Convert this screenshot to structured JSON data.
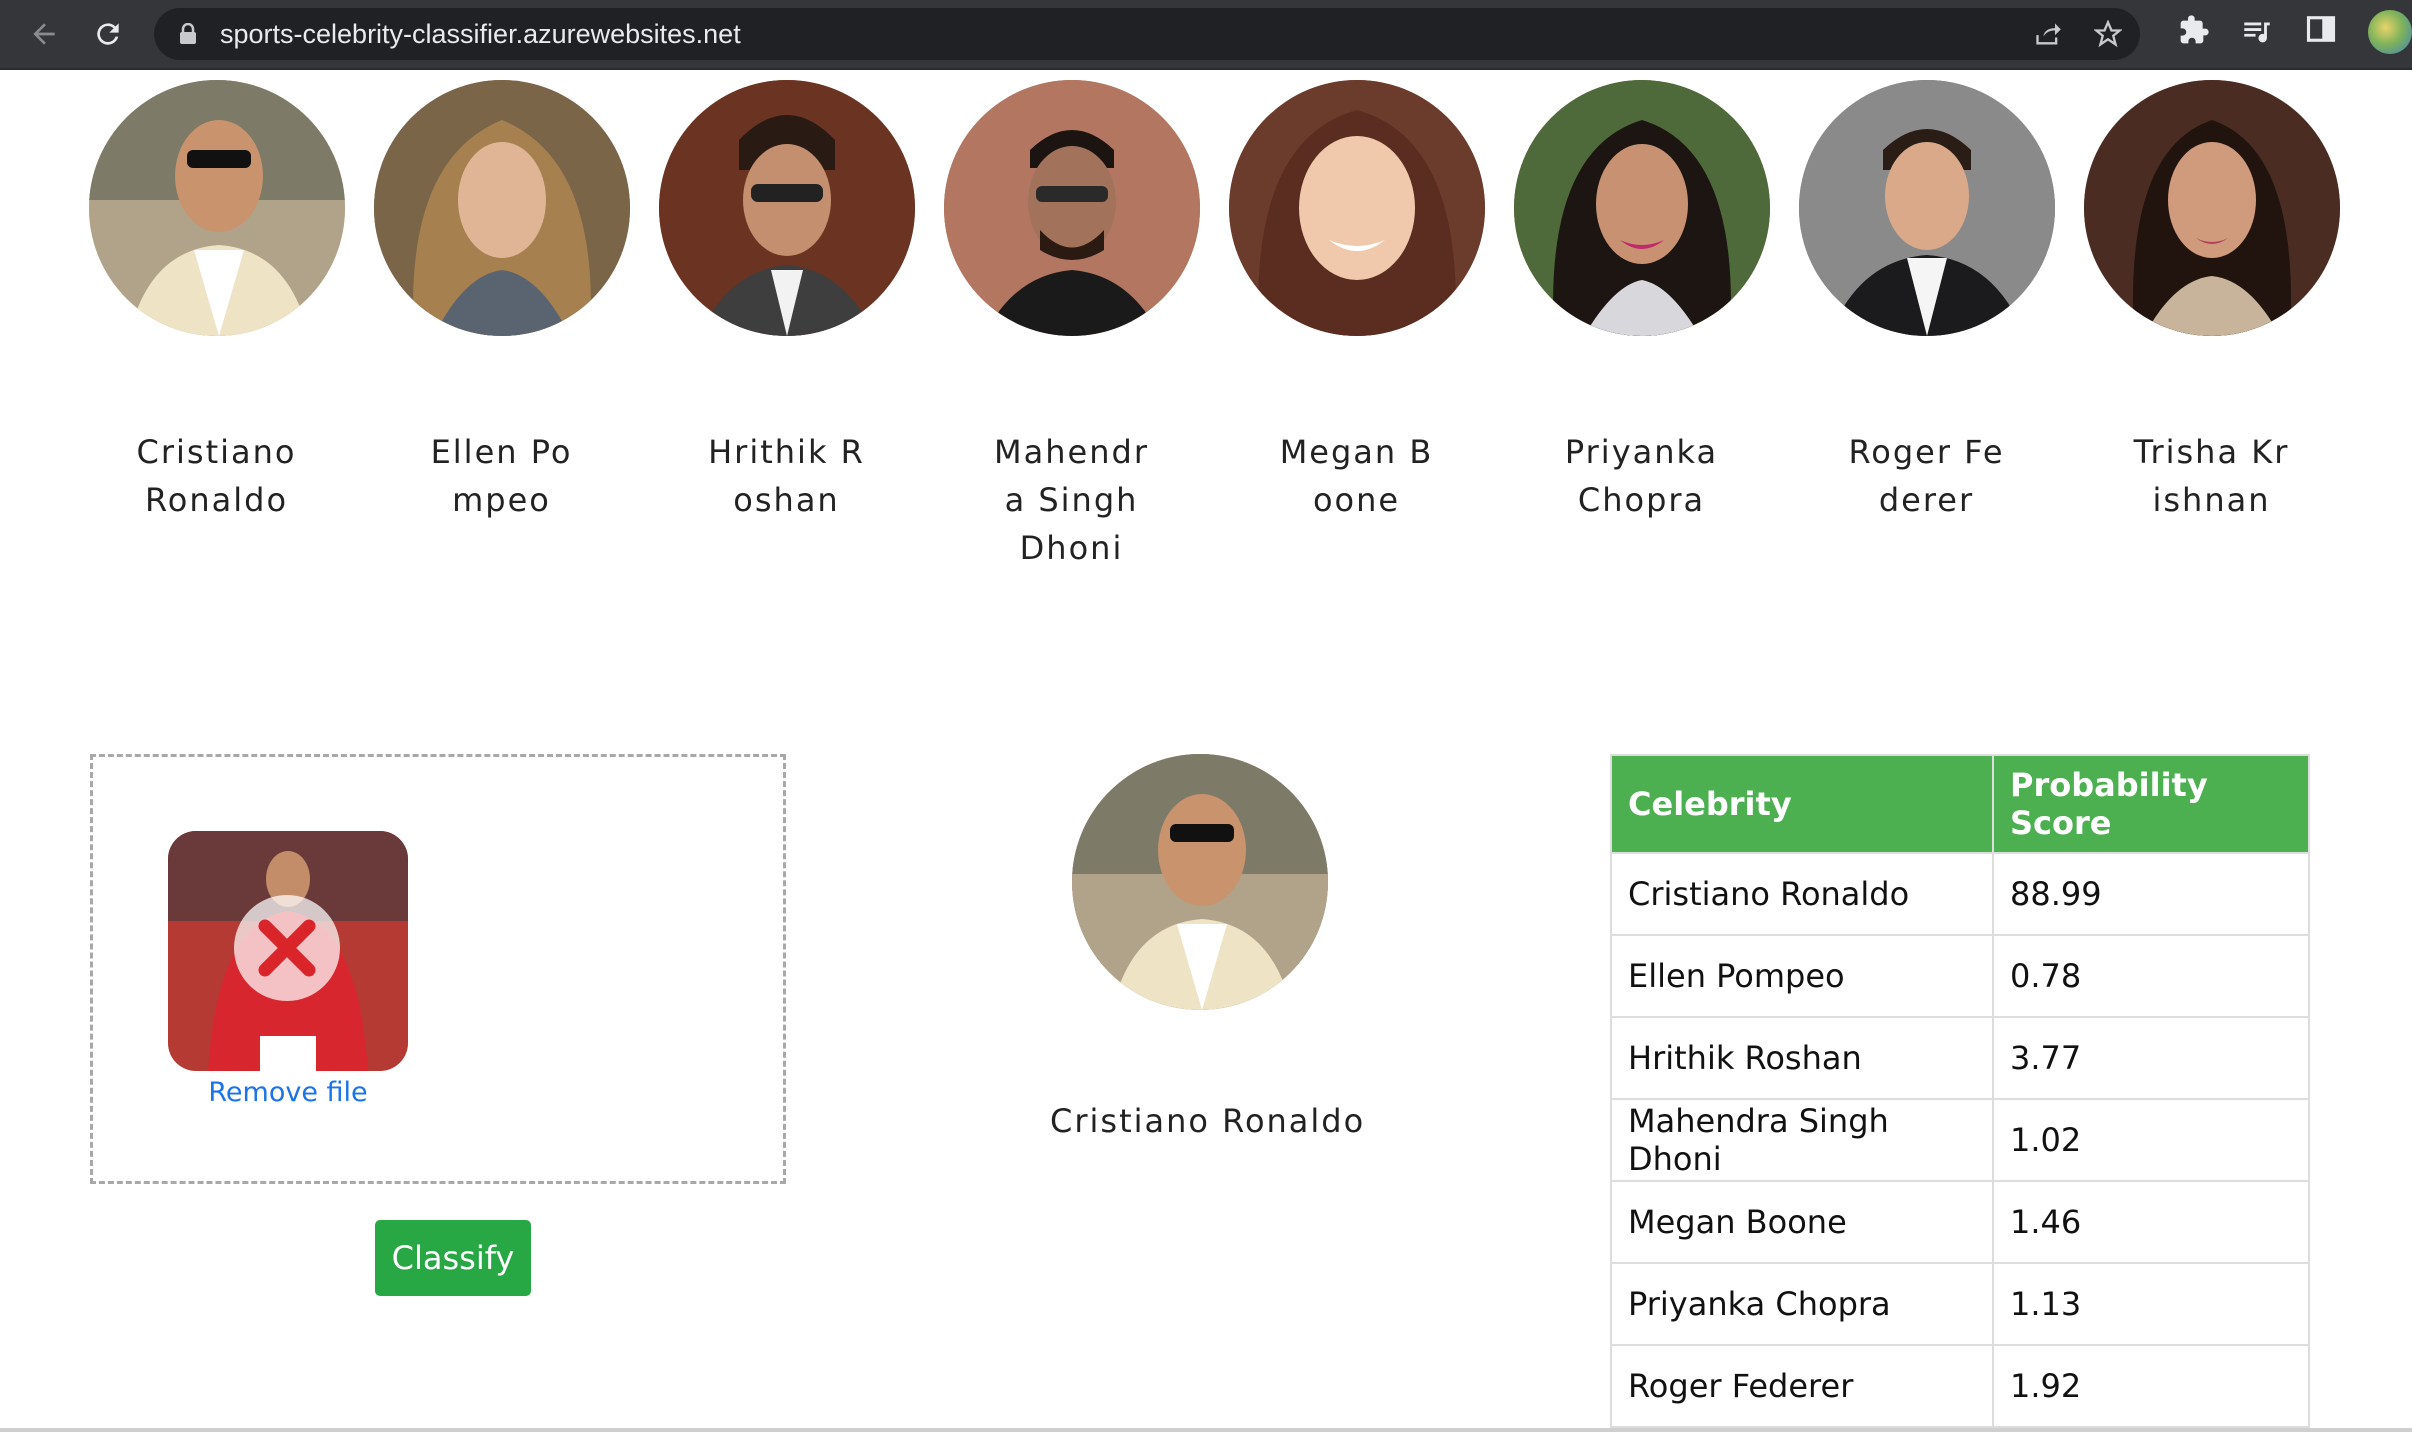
{
  "browser": {
    "url": "sports-celebrity-classifier.azurewebsites.net",
    "icons": [
      "back-arrow-icon",
      "reload-icon",
      "lock-icon",
      "share-icon",
      "star-icon",
      "extensions-icon",
      "media-icon",
      "sidebar-icon",
      "profile-avatar"
    ]
  },
  "gallery": [
    {
      "name": "Cristiano Ronaldo",
      "color": "#c9b79a"
    },
    {
      "name": "Ellen Pompeo",
      "color": "#8c7452"
    },
    {
      "name": "Hrithik Roshan",
      "color": "#6b3a2a"
    },
    {
      "name": "Mahendra Singh Dhoni",
      "color": "#b77a62"
    },
    {
      "name": "Megan Boone",
      "color": "#7a4a3a"
    },
    {
      "name": "Priyanka Chopra",
      "color": "#4d5a3a"
    },
    {
      "name": "Roger Federer",
      "color": "#6e6e6e"
    },
    {
      "name": "Trisha Krishnan",
      "color": "#5a3a30"
    }
  ],
  "upload": {
    "remove_label": "Remove file",
    "classify_label": "Classify"
  },
  "result": {
    "name": "Cristiano Ronaldo"
  },
  "table": {
    "headers": [
      "Celebrity",
      "Probability Score"
    ],
    "rows": [
      [
        "Cristiano Ronaldo",
        "88.99"
      ],
      [
        "Ellen Pompeo",
        "0.78"
      ],
      [
        "Hrithik Roshan",
        "3.77"
      ],
      [
        "Mahendra Singh Dhoni",
        "1.02"
      ],
      [
        "Megan Boone",
        "1.46"
      ],
      [
        "Priyanka Chopra",
        "1.13"
      ],
      [
        "Roger Federer",
        "1.92"
      ]
    ]
  },
  "colors": {
    "table_header": "#4caf50",
    "classify_button": "#28a745",
    "link": "#1a73e8"
  }
}
